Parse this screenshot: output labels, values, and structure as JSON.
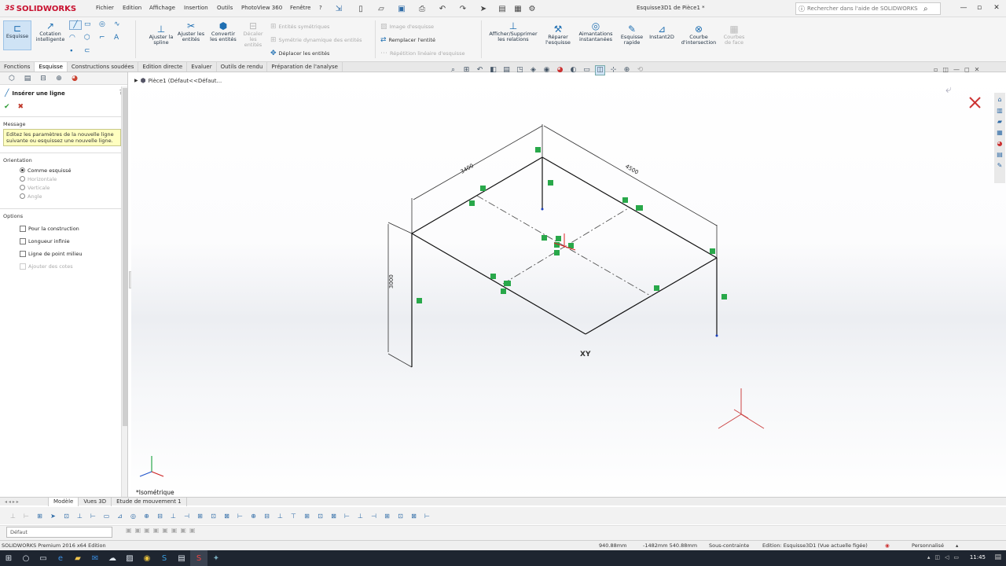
{
  "app": {
    "brand": "SOLIDWORKS",
    "brand_prefix": "3S",
    "document_title": "Esquisse3D1 de Pièce1 *",
    "menus": [
      "Fichier",
      "Edition",
      "Affichage",
      "Insertion",
      "Outils",
      "PhotoView 360",
      "Fenêtre",
      "?"
    ],
    "search_placeholder": "Rechercher dans l'aide de SOLIDWORKS"
  },
  "ribbon": {
    "esquisse": "Esquisse",
    "cotation": "Cotation intelligente",
    "ajuster_spline": "Ajuster la spline",
    "ajuster_entites": "Ajuster les entités",
    "convertir_entites": "Convertir les entités",
    "decaler_entites": "Décaler les entités",
    "entites_symetriques": "Entités symétriques",
    "symetrie_dynamique": "Symétrie dynamique des entités",
    "deplacer_entites": "Déplacer les entités",
    "image_esquisse": "Image d'esquisse",
    "remplacer_entite": "Remplacer l'entité",
    "repetition_lineaire": "Répétition linéaire d'esquisse",
    "afficher_relations": "Afficher/Supprimer les relations",
    "reparer_esquisse": "Réparer l'esquisse",
    "aimantations": "Aimantations instantanées",
    "esquisse_rapide": "Esquisse rapide",
    "instant2d": "Instant2D",
    "courbe_intersection": "Courbe d'intersection",
    "courbes_face": "Courbes de face"
  },
  "tabs": [
    "Fonctions",
    "Esquisse",
    "Constructions soudées",
    "Edition directe",
    "Evaluer",
    "Outils de rendu",
    "Préparation de l'analyse"
  ],
  "tree": {
    "item": "Pièce1  (Défaut<<Défaut..."
  },
  "panel": {
    "title": "Insérer une ligne",
    "message_header": "Message",
    "message": "Editez les paramètres de la nouvelle ligne suivante ou esquissez une nouvelle ligne.",
    "orientation_header": "Orientation",
    "orientation": [
      {
        "label": "Comme esquissé",
        "selected": true,
        "enabled": true
      },
      {
        "label": "Horizontale",
        "selected": false,
        "enabled": false
      },
      {
        "label": "Verticale",
        "selected": false,
        "enabled": false
      },
      {
        "label": "Angle",
        "selected": false,
        "enabled": false
      }
    ],
    "options_header": "Options",
    "options": [
      {
        "label": "Pour la construction",
        "checked": false,
        "enabled": true
      },
      {
        "label": "Longueur infinie",
        "checked": false,
        "enabled": true
      },
      {
        "label": "Ligne de point milieu",
        "checked": false,
        "enabled": true
      },
      {
        "label": "Ajouter des cotes",
        "checked": false,
        "enabled": false
      }
    ]
  },
  "sketch": {
    "dim_3400": "3400",
    "dim_4500": "4500",
    "dim_3000": "3000",
    "plane_label": "XY"
  },
  "view": {
    "name": "*Isométrique"
  },
  "bottom_tabs": [
    "Modèle",
    "Vues 3D",
    "Etude de mouvement 1"
  ],
  "config": {
    "value": "Défaut"
  },
  "status": {
    "edition": "SOLIDWORKS Premium 2016 x64 Edition",
    "coord1": "940.88mm",
    "coord2": "-1482mm 540.88mm",
    "state": "Sous-contrainte",
    "editing": "Edition: Esquisse3D1 (Vue actuelle figée)",
    "custom": "Personnalisé"
  },
  "taskbar": {
    "clock": "11:45"
  }
}
